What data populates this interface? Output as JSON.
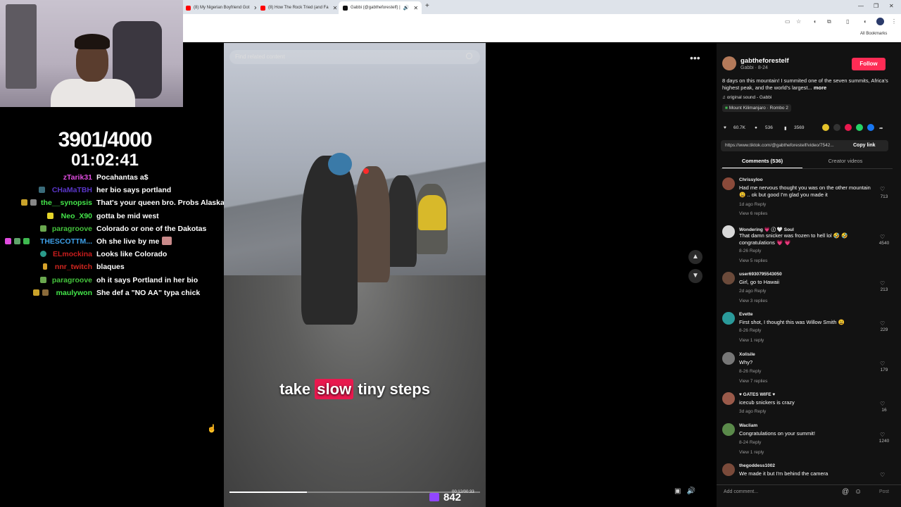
{
  "browser": {
    "tabs": [
      {
        "title": "(8) My Nigerian Boyfriend Got",
        "color": "#ff0000"
      },
      {
        "title": "(8) How The Rock Tried (and Fa",
        "color": "#ff0000"
      },
      {
        "title": "Gabbi (@gabtheforestelf) |",
        "color": "#111111"
      }
    ],
    "new_tab": "+",
    "all_bookmarks": "All Bookmarks"
  },
  "stream_overlay": {
    "counter": "3901/4000",
    "timer": "01:02:41",
    "chat": [
      {
        "user": "zTarik31",
        "color": "#e14ce0",
        "msg": "Pocahantas a$"
      },
      {
        "user": "CHaMaTBH",
        "color": "#5a36c8",
        "msg": "her bio says portland"
      },
      {
        "user": "the__synopsis",
        "color": "#44e64a",
        "msg": "That's your queen bro. Probs Alaska"
      },
      {
        "user": "Neo_X90",
        "color": "#44e64a",
        "msg": "gotta be mid west"
      },
      {
        "user": "paragroove",
        "color": "#44c23c",
        "msg": "Colorado or one of the Dakotas"
      },
      {
        "user": "THESCOTTM...",
        "color": "#3ea0e8",
        "msg": "Oh she live by me"
      },
      {
        "user": "ELmockina",
        "color": "#c81d1d",
        "msg": "Looks like Colorado"
      },
      {
        "user": "nnr_twitch",
        "color": "#d2261f",
        "msg": "blaques"
      },
      {
        "user": "paragroove",
        "color": "#44c23c",
        "msg": "oh it says Portland in her bio"
      },
      {
        "user": "maulywon",
        "color": "#44e64a",
        "msg": "She def a \"NO AA\" typa chick"
      }
    ],
    "viewers": "842"
  },
  "video": {
    "search_placeholder": "Find related content",
    "caption_pre": "take ",
    "caption_highlight": "slow",
    "caption_post": " tiny steps",
    "time": "00:12/00:33",
    "progress": 0.31
  },
  "post": {
    "username": "gabtheforestelf",
    "subline": "Gabbi · 8-24",
    "follow": "Follow",
    "description": "8 days on this mountain! I summited one of the seven summits, Africa's highest peak, and the world's largest...",
    "more": "more",
    "sound": "original sound - Gabbi",
    "location": "Mount Kilimanjaro · Rombo  2",
    "likes": "60.7K",
    "comments": "536",
    "saves": "3569",
    "link": "https://www.tiktok.com/@gabtheforestelf/video/7542...",
    "copy_link": "Copy link",
    "tab_comments": "Comments (536)",
    "tab_creator": "Creator videos"
  },
  "comments": [
    {
      "name": "Chrissyloo",
      "text": "Had me nervous thought you was on the other mountain 😩 .. ok but good I'm glad you made it",
      "meta": "1d ago   Reply",
      "replies": "View 6 replies",
      "likes": "713",
      "avatar": "#8a4a3a"
    },
    {
      "name": "Wondering 💗 ⓘ 🤍 Soul",
      "text": "That damn snicker was frozen to hell lol 🤣 🤣 congratulations 💗 💗",
      "meta": "8-26   Reply",
      "replies": "View 5 replies",
      "likes": "4540",
      "avatar": "#d8d8d8"
    },
    {
      "name": "user6930795543050",
      "text": "Girl, go to Hawaii",
      "meta": "2d ago   Reply",
      "replies": "View 3 replies",
      "likes": "213",
      "avatar": "#6b4a3a"
    },
    {
      "name": "Evette",
      "text": "First shot, I thought this was Willow Smith 😩",
      "meta": "8-26   Reply",
      "replies": "View 1 reply",
      "likes": "229",
      "avatar": "#2a9a9a"
    },
    {
      "name": "Xolisile",
      "text": "Why?",
      "meta": "8-26   Reply",
      "replies": "View 7 replies",
      "likes": "179",
      "avatar": "#777777"
    },
    {
      "name": "♥ GATES WIFE ♥",
      "text": "icecub snickers is crazy",
      "meta": "3d ago   Reply",
      "replies": "",
      "likes": "16",
      "avatar": "#9a5a4a"
    },
    {
      "name": "Wacliam",
      "text": "Congratulations on your summit!",
      "meta": "8-24   Reply",
      "replies": "View 1 reply",
      "likes": "1240",
      "avatar": "#5a8a4a"
    },
    {
      "name": "thegoddess1002",
      "text": "We made it but I'm behind the camera",
      "meta": "",
      "replies": "",
      "likes": "",
      "avatar": "#7a4a3a"
    }
  ],
  "composer": {
    "placeholder": "Add comment...",
    "post": "Post"
  }
}
